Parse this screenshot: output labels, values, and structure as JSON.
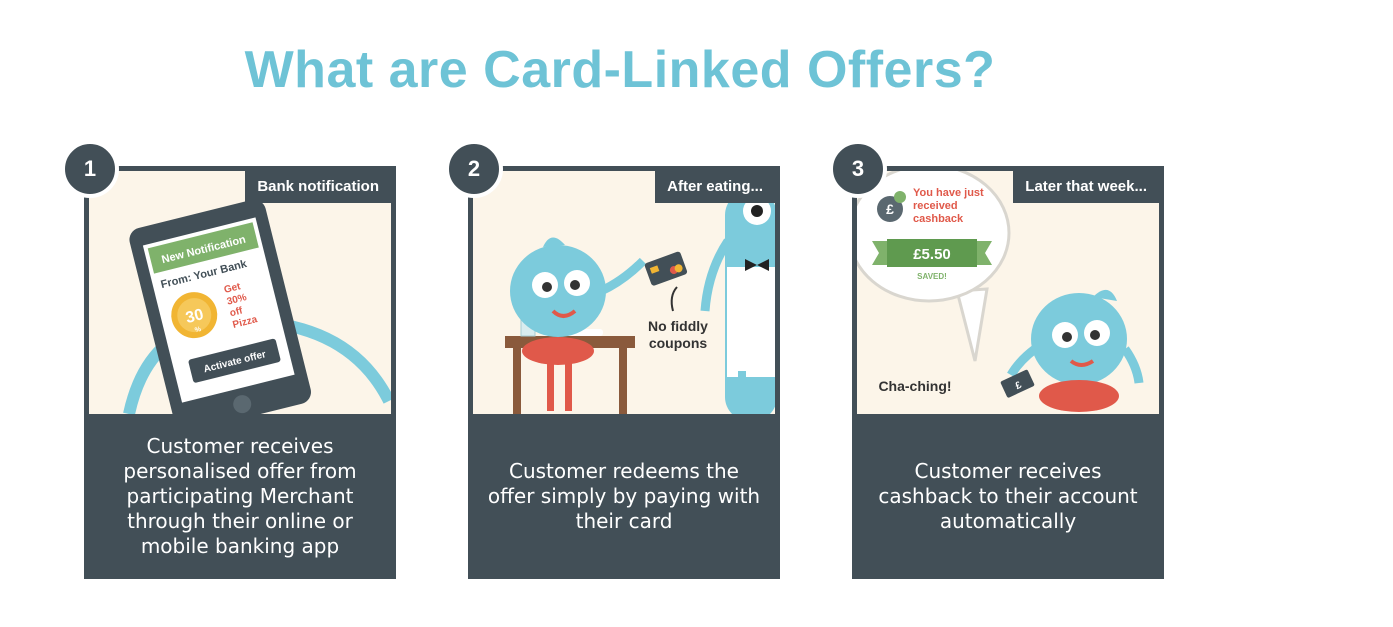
{
  "title": "What are Card-Linked Offers?",
  "steps": [
    {
      "number": "1",
      "tag": "Bank notification",
      "caption": "Customer receives personalised offer from participating Merchant through their online or mobile banking app",
      "phone": {
        "notification": "New Notification",
        "from": "From: Your Bank",
        "badge": "30",
        "badge_unit": "%",
        "offer_line1": "Get",
        "offer_line2": "30%",
        "offer_line3": "off",
        "offer_line4": "Pizza",
        "button": "Activate offer"
      }
    },
    {
      "number": "2",
      "tag": "After eating...",
      "caption": "Customer redeems the offer simply by paying with their card",
      "note_line1": "No fiddly",
      "note_line2": "coupons"
    },
    {
      "number": "3",
      "tag": "Later that week...",
      "caption": "Customer receives cashback to their account automatically",
      "bubble_line1": "You have just",
      "bubble_line2": "received",
      "bubble_line3": "cashback",
      "amount": "£5.50",
      "saved": "SAVED!",
      "sound": "Cha-ching!",
      "currency_icon": "£"
    }
  ],
  "colors": {
    "title": "#6ec3d6",
    "panel": "#424f57",
    "scene_bg": "#fcf5e9",
    "creature": "#7ccbdc",
    "accent_red": "#e0594a",
    "accent_green": "#7fb26b"
  }
}
